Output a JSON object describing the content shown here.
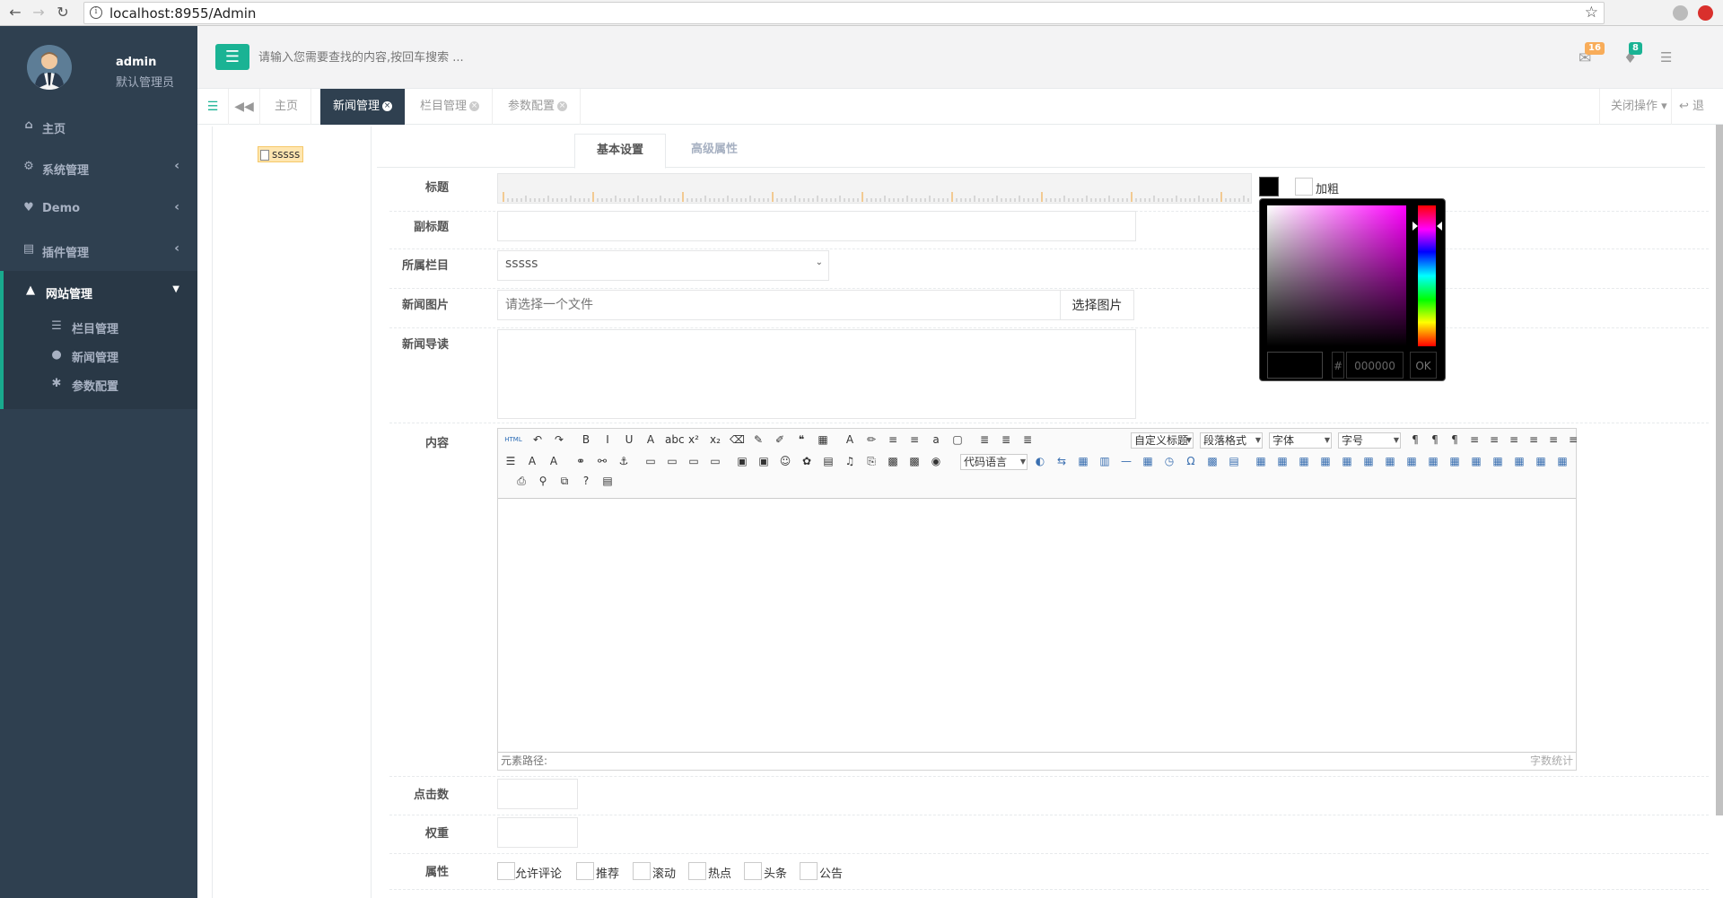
{
  "browser": {
    "url": "localhost:8955/Admin"
  },
  "sidebar": {
    "user_name": "admin",
    "user_role": "默认管理员",
    "items": [
      {
        "label": "主页",
        "icon": "home-icon"
      },
      {
        "label": "系统管理",
        "icon": "gear-icon"
      },
      {
        "label": "Demo",
        "icon": "heart-icon"
      },
      {
        "label": "插件管理",
        "icon": "book-icon"
      },
      {
        "label": "网站管理",
        "icon": "sitemap-icon"
      }
    ],
    "submenu": [
      {
        "label": "栏目管理",
        "icon": "list-icon"
      },
      {
        "label": "新闻管理",
        "icon": "globe-icon"
      },
      {
        "label": "参数配置",
        "icon": "cog-icon"
      }
    ]
  },
  "topbar": {
    "search_placeholder": "请输入您需要查找的内容,按回车搜索 ...",
    "mail_count": "16",
    "bell_count": "8"
  },
  "tabs": {
    "items": [
      "主页",
      "新闻管理",
      "栏目管理",
      "参数配置"
    ],
    "close_ops": "关闭操作",
    "logout": "退出"
  },
  "tree": {
    "node": "sssss"
  },
  "form": {
    "tabs": [
      "基本设置",
      "高级属性"
    ],
    "labels": {
      "title": "标题",
      "subtitle": "副标题",
      "category": "所属栏目",
      "image": "新闻图片",
      "summary": "新闻导读",
      "content": "内容",
      "clicks": "点击数",
      "weight": "权重",
      "attrs": "属性"
    },
    "bold_label": "加粗",
    "category_value": "sssss",
    "image_placeholder": "请选择一个文件",
    "image_button": "选择图片",
    "attributes": [
      "允许评论",
      "推荐",
      "滚动",
      "热点",
      "头条",
      "公告"
    ]
  },
  "editor": {
    "selects": {
      "code_lang": "代码语言",
      "custom_title": "自定义标题",
      "paragraph": "段落格式",
      "font": "字体",
      "size": "字号"
    },
    "footer_path": "元素路径:",
    "footer_count": "字数统计"
  },
  "color_picker": {
    "hash": "#",
    "hex": "000000",
    "ok": "OK"
  },
  "colors": {
    "sidebar_bg": "#2f4050",
    "accent": "#1ab394",
    "mail_badge": "#f8ac59",
    "bell_badge": "#1ab394"
  }
}
